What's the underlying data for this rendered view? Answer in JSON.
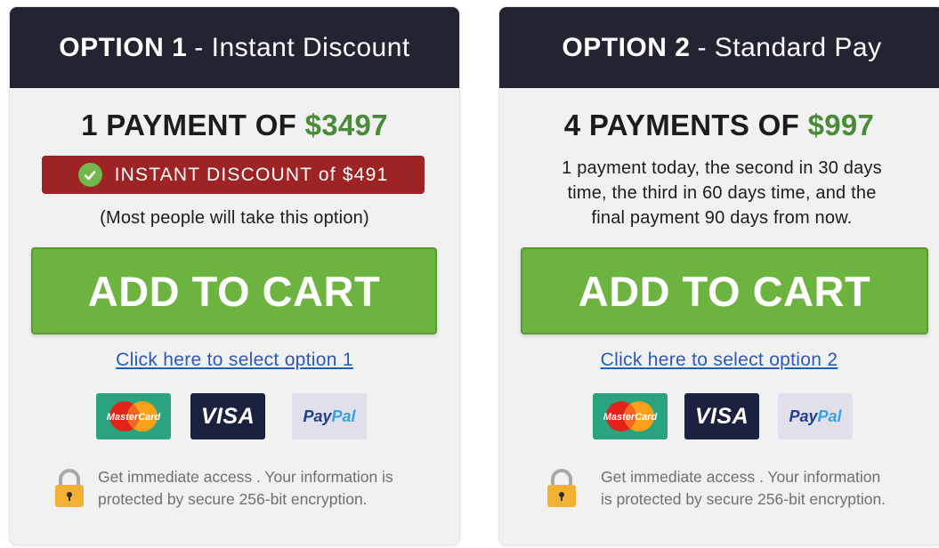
{
  "option1": {
    "header_number": "OPTION 1",
    "header_subtitle": "- Instant Discount",
    "title_prefix": "1 PAYMENT OF ",
    "price": "$3497",
    "badge_text": "INSTANT DISCOUNT of $491",
    "note": "(Most people will take this option)",
    "cart_button_label": "ADD TO CART",
    "select_link": "Click here to select option 1",
    "secure_line1": "Get immediate access . Your information is",
    "secure_line2": "protected by secure 256-bit encryption."
  },
  "option2": {
    "header_number": "OPTION 2",
    "header_subtitle": "- Standard Pay",
    "title_prefix": "4 PAYMENTS OF ",
    "price": "$997",
    "desc_line1": "1 payment today, the second in 30 days",
    "desc_line2": "time, the third in 60 days time, and the",
    "desc_line3": "final payment 90 days from now.",
    "cart_button_label": "ADD TO CART",
    "select_link": "Click here to select option 2",
    "secure_line1": "Get immediate access . Your information",
    "secure_line2": "is protected by secure 256-bit encryption."
  },
  "payment_logos": {
    "mastercard": "MasterCard",
    "visa": "VISA",
    "paypal_part1": "Pay",
    "paypal_part2": "Pal"
  },
  "icons": [
    "check-circle-icon",
    "mastercard-logo",
    "visa-logo",
    "paypal-logo",
    "padlock-icon"
  ],
  "colors": {
    "header_bg": "#232431",
    "price_green": "#4a8b3a",
    "badge_red": "#9d2324",
    "button_green": "#6db33f",
    "link_blue": "#2f58b4"
  }
}
